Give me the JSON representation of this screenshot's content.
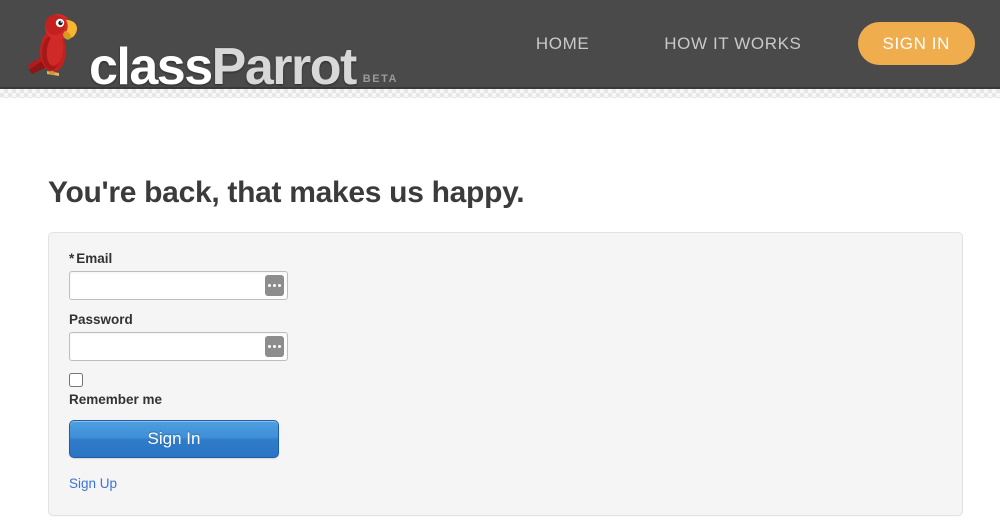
{
  "header": {
    "logo": {
      "icon": "parrot-logo-icon",
      "text_primary": "class",
      "text_secondary": "Parrot",
      "badge": "BETA"
    },
    "nav": [
      {
        "label": "HOME",
        "name": "nav-home"
      },
      {
        "label": "HOW IT WORKS",
        "name": "nav-how-it-works"
      }
    ],
    "signin_button": "SIGN IN",
    "background_color": "#4a4a4a",
    "accent_color": "#f0ad4e"
  },
  "main": {
    "page_title": "You're back, that makes us happy.",
    "form": {
      "email": {
        "label": "Email",
        "required_marker": "*",
        "value": "",
        "placeholder": "",
        "autofill_icon": "autofill-dots-icon"
      },
      "password": {
        "label": "Password",
        "value": "",
        "placeholder": "",
        "autofill_icon": "autofill-dots-icon"
      },
      "remember_me": {
        "label": "Remember me",
        "checked": false
      },
      "submit_label": "Sign In",
      "signup_link": "Sign Up",
      "submit_color": "#2f7ccb",
      "link_color": "#3b73d6"
    }
  }
}
